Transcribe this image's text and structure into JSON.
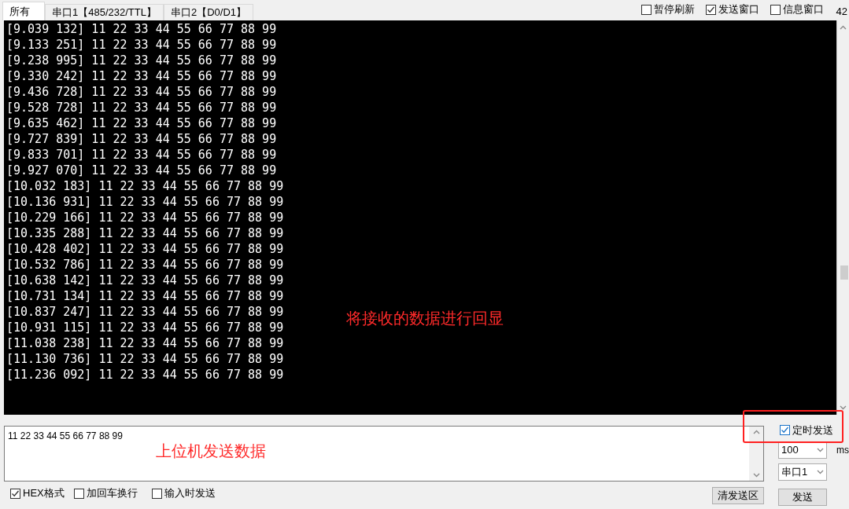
{
  "tabs": [
    {
      "label": "所有",
      "selected": true
    },
    {
      "label": "串口1【485/232/TTL】",
      "selected": false
    },
    {
      "label": "串口2【D0/D1】",
      "selected": false
    }
  ],
  "top_options": [
    {
      "label": "暂停刷新",
      "checked": false
    },
    {
      "label": "发送窗口",
      "checked": true
    },
    {
      "label": "信息窗口",
      "checked": false
    }
  ],
  "corner_text": "42",
  "receive_lines": [
    "[9.039 132] 11 22 33 44 55 66 77 88 99",
    "[9.133 251] 11 22 33 44 55 66 77 88 99",
    "[9.238 995] 11 22 33 44 55 66 77 88 99",
    "[9.330 242] 11 22 33 44 55 66 77 88 99",
    "[9.436 728] 11 22 33 44 55 66 77 88 99",
    "[9.528 728] 11 22 33 44 55 66 77 88 99",
    "[9.635 462] 11 22 33 44 55 66 77 88 99",
    "[9.727 839] 11 22 33 44 55 66 77 88 99",
    "[9.833 701] 11 22 33 44 55 66 77 88 99",
    "[9.927 070] 11 22 33 44 55 66 77 88 99",
    "[10.032 183] 11 22 33 44 55 66 77 88 99",
    "[10.136 931] 11 22 33 44 55 66 77 88 99",
    "[10.229 166] 11 22 33 44 55 66 77 88 99",
    "[10.335 288] 11 22 33 44 55 66 77 88 99",
    "[10.428 402] 11 22 33 44 55 66 77 88 99",
    "[10.532 786] 11 22 33 44 55 66 77 88 99",
    "[10.638 142] 11 22 33 44 55 66 77 88 99",
    "[10.731 134] 11 22 33 44 55 66 77 88 99",
    "[10.837 247] 11 22 33 44 55 66 77 88 99",
    "[10.931 115] 11 22 33 44 55 66 77 88 99",
    "[11.038 238] 11 22 33 44 55 66 77 88 99",
    "[11.130 736] 11 22 33 44 55 66 77 88 99",
    "[11.236 092] 11 22 33 44 55 66 77 88 99"
  ],
  "receive_annotation": "将接收的数据进行回显",
  "send_text": "11 22 33 44 55 66 77 88 99",
  "send_annotation": "上位机发送数据",
  "bottom_options": [
    {
      "label": "HEX格式",
      "checked": true
    },
    {
      "label": "加回车换行",
      "checked": false
    },
    {
      "label": "输入时发送",
      "checked": false
    }
  ],
  "timed_send": {
    "label": "定时发送",
    "checked": true
  },
  "interval": {
    "value": "100",
    "unit": "ms"
  },
  "port_select": {
    "value": "串口1"
  },
  "buttons": {
    "clear": "清发送区",
    "send": "发送"
  }
}
